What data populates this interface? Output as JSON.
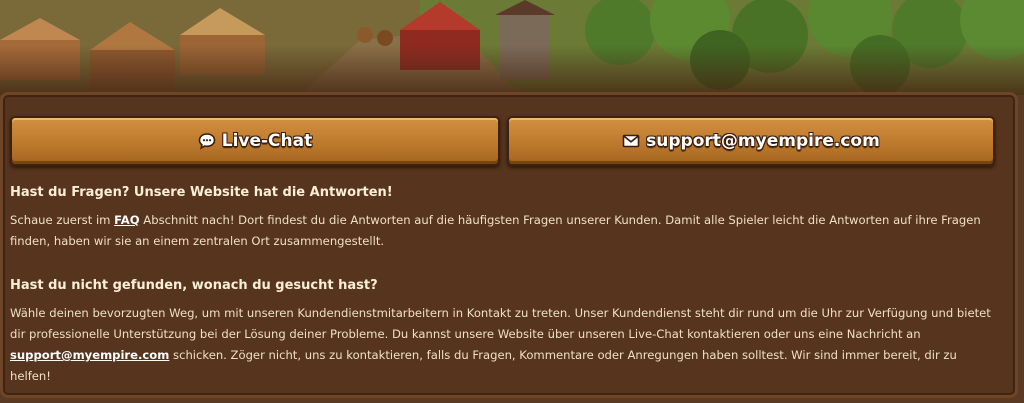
{
  "buttons": {
    "live_chat": "Live-Chat",
    "email": "support@myempire.com"
  },
  "section1": {
    "heading": "Hast du Fragen? Unsere Website hat die Antworten!",
    "text_before_link": "Schaue zuerst im ",
    "link": "FAQ",
    "text_after_link": " Abschnitt nach! Dort findest du die Antworten auf die häufigsten Fragen unserer Kunden. Damit alle Spieler leicht die Antworten auf ihre Fragen finden, haben wir sie an einem zentralen Ort zusammengestellt."
  },
  "section2": {
    "heading": "Hast du nicht gefunden, wonach du gesucht hast?",
    "text_before_link": "Wähle deinen bevorzugten Weg, um mit unseren Kundendienstmitarbeitern in Kontakt zu treten. Unser Kundendienst steht dir rund um die Uhr zur Verfügung und bietet dir professionelle Unterstützung bei der Lösung deiner Probleme. Du kannst unsere Website über unseren Live-Chat kontaktieren oder uns eine Nachricht an ",
    "link": "support@myempire.com",
    "text_after_link": " schicken. Zöger nicht, uns zu kontaktieren, falls du Fragen, Kommentare oder Anregungen haben solltest. Wir sind immer bereit, dir zu helfen!"
  },
  "icons": {
    "chat": "chat-bubble-icon",
    "mail": "envelope-icon"
  }
}
